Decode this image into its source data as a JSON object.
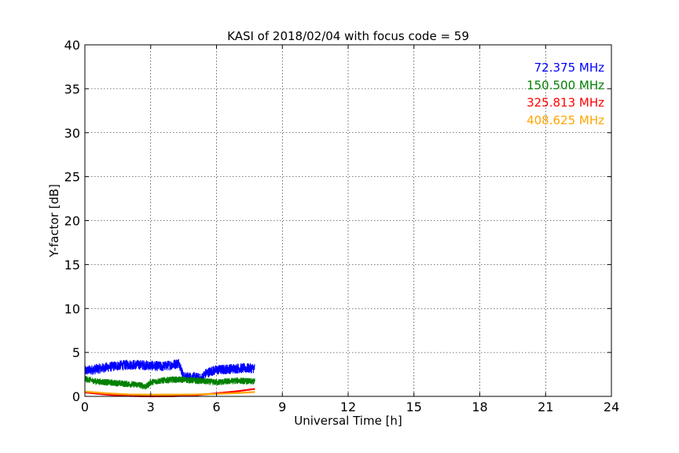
{
  "chart_data": {
    "type": "line",
    "title": "KASI of 2018/02/04 with focus code = 59",
    "xlabel": "Universal Time [h]",
    "ylabel": "Y-factor [dB]",
    "xlim": [
      0,
      24
    ],
    "ylim": [
      0,
      40
    ],
    "xticks": [
      0,
      3,
      6,
      9,
      12,
      15,
      18,
      21,
      24
    ],
    "yticks": [
      0,
      5,
      10,
      15,
      20,
      25,
      30,
      35,
      40
    ],
    "grid": true,
    "legend_position": "top-right",
    "series": [
      {
        "name": "72.375 MHz",
        "color": "#0000ff",
        "noise": 0.55,
        "x": [
          0,
          0.5,
          1,
          1.5,
          2,
          2.5,
          3,
          3.5,
          4,
          4.3,
          4.5,
          5,
          5.3,
          5.5,
          5.8,
          6,
          6.5,
          7,
          7.5,
          7.75
        ],
        "y": [
          2.9,
          3.1,
          3.3,
          3.5,
          3.6,
          3.6,
          3.5,
          3.4,
          3.6,
          3.8,
          2.2,
          2.2,
          2.0,
          2.6,
          2.9,
          3.0,
          3.1,
          3.2,
          3.2,
          3.2
        ]
      },
      {
        "name": "150.500 MHz",
        "color": "#008000",
        "noise": 0.35,
        "x": [
          0,
          0.5,
          1,
          1.5,
          2,
          2.5,
          2.8,
          3,
          3.5,
          4,
          4.5,
          5,
          5.5,
          6,
          6.5,
          7,
          7.5,
          7.75
        ],
        "y": [
          2.0,
          1.7,
          1.6,
          1.5,
          1.4,
          1.3,
          1.1,
          1.6,
          1.8,
          1.9,
          1.9,
          1.8,
          1.7,
          1.6,
          1.7,
          1.8,
          1.7,
          1.7
        ]
      },
      {
        "name": "325.813 MHz",
        "color": "#ff0000",
        "noise": 0.0,
        "x": [
          0,
          1,
          2,
          3,
          4,
          5,
          6,
          7,
          7.75
        ],
        "y": [
          0.45,
          0.2,
          0.05,
          0.0,
          0.02,
          0.12,
          0.35,
          0.6,
          0.85
        ]
      },
      {
        "name": "408.625 MHz",
        "color": "#ffa500",
        "noise": 0.0,
        "x": [
          0,
          1,
          2,
          3,
          4,
          5,
          6,
          7,
          7.75
        ],
        "y": [
          0.55,
          0.35,
          0.22,
          0.2,
          0.2,
          0.22,
          0.28,
          0.38,
          0.5
        ]
      }
    ]
  }
}
